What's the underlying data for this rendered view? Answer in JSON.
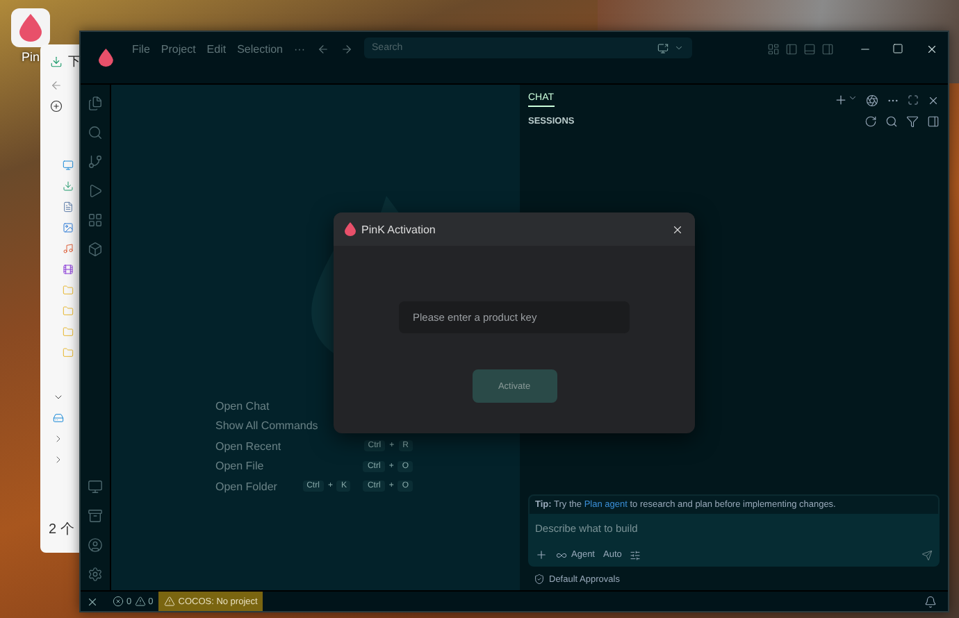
{
  "desktop": {
    "shortcut": {
      "label": "Pin"
    },
    "explorer": {
      "tab": "下",
      "footer": "2 个"
    }
  },
  "window": {
    "menu": [
      "File",
      "Project",
      "Edit",
      "Selection",
      "···"
    ],
    "search": {
      "placeholder": "Search"
    }
  },
  "welcome": {
    "commands": [
      {
        "label": "Open Chat"
      },
      {
        "label": "Show All Commands"
      },
      {
        "label": "Open Recent",
        "shortcut": [
          {
            "kind": "key",
            "text": "Ctrl"
          },
          {
            "kind": "plus",
            "text": "+"
          },
          {
            "kind": "key",
            "text": "R"
          }
        ]
      },
      {
        "label": "Open File",
        "shortcut": [
          {
            "kind": "key",
            "text": "Ctrl"
          },
          {
            "kind": "plus",
            "text": "+"
          },
          {
            "kind": "key",
            "text": "O"
          }
        ]
      },
      {
        "label": "Open Folder",
        "shortcut": [
          {
            "kind": "key",
            "text": "Ctrl"
          },
          {
            "kind": "plus",
            "text": "+"
          },
          {
            "kind": "key",
            "text": "K"
          },
          {
            "kind": "gap"
          },
          {
            "kind": "key",
            "text": "Ctrl"
          },
          {
            "kind": "plus",
            "text": "+"
          },
          {
            "kind": "key",
            "text": "O"
          }
        ]
      }
    ]
  },
  "chat": {
    "tabs": [
      {
        "label": "CHAT",
        "selected": true
      }
    ],
    "section": "SESSIONS",
    "tip": {
      "label": "Tip:",
      "before": "Try the",
      "link": "Plan agent",
      "after": "to research and plan before implementing changes."
    },
    "input": {
      "placeholder": "Describe what to build"
    },
    "mode": "Agent",
    "model": "Auto",
    "approvals": "Default Approvals"
  },
  "status_bar": {
    "errors": "0",
    "warnings": "0",
    "project": "COCOS: No project"
  },
  "dialog": {
    "title": "PinK Activation",
    "input": {
      "placeholder": "Please enter a product key"
    },
    "button": {
      "label": "Activate",
      "disabled": true
    }
  }
}
